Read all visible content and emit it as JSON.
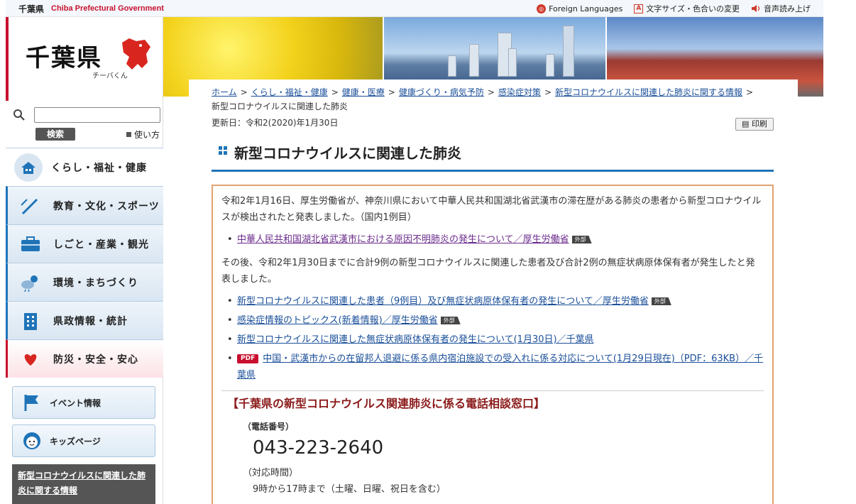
{
  "topbar": {
    "pref_name": "千葉県",
    "pref_name_en": "Chiba Prefectural Government",
    "links": [
      "Foreign Languages",
      "文字サイズ・色合いの変更",
      "音声読み上げ"
    ]
  },
  "sidebar": {
    "logo": "千葉県",
    "mascot": "チーバくん",
    "search_button": "検索",
    "howto": "使い方",
    "nav": [
      {
        "label": "くらし・福祉・健康",
        "icon": "house-icon"
      },
      {
        "label": "教育・文化・スポーツ",
        "icon": "pen-icon"
      },
      {
        "label": "しごと・産業・観光",
        "icon": "briefcase-icon"
      },
      {
        "label": "環境・まちづくり",
        "icon": "weather-icon"
      },
      {
        "label": "県政情報・統計",
        "icon": "building-icon"
      },
      {
        "label": "防災・安全・安心",
        "icon": "heart-icon"
      }
    ],
    "sub": [
      {
        "label": "イベント情報",
        "icon": "flag-icon"
      },
      {
        "label": "キッズページ",
        "icon": "kid-face-icon"
      }
    ],
    "corona_link": "新型コロナウイルスに関連した肺炎に関する情報"
  },
  "main": {
    "breadcrumbs": [
      "ホーム",
      "くらし・福祉・健康",
      "健康・医療",
      "健康づくり・病気予防",
      "感染症対策",
      "新型コロナウイルスに関連した肺炎に関する情報"
    ],
    "breadcrumb_current": "新型コロナウイルスに関連した肺炎",
    "updated": "更新日：令和2(2020)年1月30日",
    "print": "印刷",
    "title": "新型コロナウイルスに関連した肺炎",
    "para1": "令和2年1月16日、厚生労働省が、神奈川県において中華人民共和国湖北省武漢市の滞在歴がある肺炎の患者から新型コロナウイルスが検出されたと発表しました。（国内1例目）",
    "link1": "中華人民共和国湖北省武漢市における原因不明肺炎の発生について／厚生労働省",
    "para2": "その後、令和2年1月30日までに合計9例の新型コロナウイルスに関連した患者及び合計2例の無症状病原体保有者が発生したと発表しました。",
    "links2": [
      {
        "text": "新型コロナウイルスに関連した患者（9例目）及び無症状病原体保有者の発生について／厚生労働省",
        "ext": true
      },
      {
        "text": "感染症情報のトピックス(新着情報)／厚生労働省",
        "ext": true
      },
      {
        "text": "新型コロナウイルスに関連した無症状病原体保有者の発生について(1月30日)／千葉県",
        "ext": false
      },
      {
        "text": "中国・武漢市からの在留邦人退避に係る県内宿泊施設での受入れに係る対応について(1月29日現在)（PDF：63KB）／千葉県",
        "ext": false,
        "pdf": true
      }
    ],
    "external_badge": "外部",
    "pdf_badge": "PDF",
    "tel_heading": "【千葉県の新型コロナウイルス関連肺炎に係る電話相談窓口】",
    "tel_label": "（電話番号）",
    "tel_number": "043-223-2640",
    "hours_label": "（対応時間）",
    "hours": "9時から17時まで（土曜、日曜、祝日を含む）"
  }
}
